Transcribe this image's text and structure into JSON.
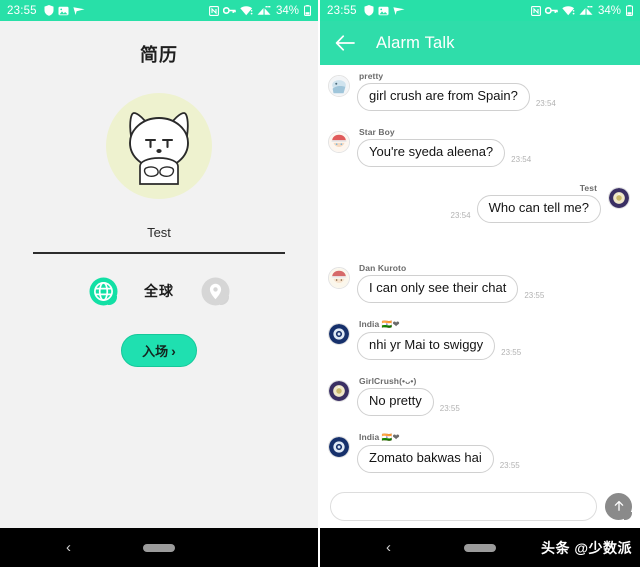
{
  "status_bar": {
    "time": "23:55",
    "battery": "34%",
    "left_icons": [
      "shield-icon",
      "gallery-icon",
      "send-plane-icon"
    ],
    "right_icons": [
      "nfc-icon",
      "vpn-key-icon",
      "wifi-icon",
      "signal-icon",
      "battery-icon"
    ]
  },
  "colors": {
    "accent": "#28e0a8",
    "appbar": "#2fddaa",
    "enter_button": "#1fe0b0",
    "avatar_bg": "#eef2cf",
    "nav_bar": "#000000"
  },
  "profile": {
    "title": "简历",
    "avatar_icon": "white-cat-avatar",
    "name": "Test",
    "scope": {
      "globe_icon": "globe-icon",
      "label": "全球",
      "pin_icon": "location-pin-icon"
    },
    "enter_button": {
      "label": "入场",
      "chevron": "›"
    }
  },
  "chat": {
    "back_icon": "back-arrow-icon",
    "title": "Alarm Talk",
    "messages": [
      {
        "sender": "pretty",
        "text": "girl crush are from Spain?",
        "time": "23:54",
        "side": "in",
        "avatar": "avatar-pretty"
      },
      {
        "sender": "Star Boy",
        "text": "You're syeda aleena?",
        "time": "23:54",
        "side": "in",
        "avatar": "avatar-starboy"
      },
      {
        "sender": "Test",
        "text": "Who can tell me?",
        "time": "23:54",
        "side": "out",
        "avatar": "avatar-test"
      },
      {
        "sender": "Dan Kuroto",
        "text": "I can only see their chat",
        "time": "23:55",
        "side": "in",
        "avatar": "avatar-dankuroto"
      },
      {
        "sender": "India 🇮🇳❤",
        "text": "nhi yr Mai to swiggy",
        "time": "23:55",
        "side": "in",
        "avatar": "avatar-india"
      },
      {
        "sender": "GirlCrush(•ᴗ•)",
        "text": "No pretty",
        "time": "23:55",
        "side": "in",
        "avatar": "avatar-girlcrush"
      },
      {
        "sender": "India 🇮🇳❤",
        "text": "Zomato bakwas hai",
        "time": "23:55",
        "side": "in",
        "avatar": "avatar-india"
      }
    ],
    "composer": {
      "value": "",
      "placeholder": "",
      "send_icon": "send-up-arrow-icon"
    }
  },
  "nav_bar": {
    "back_glyph": "‹",
    "home_pill": "home-pill",
    "watermark": "头条 @少数派"
  }
}
